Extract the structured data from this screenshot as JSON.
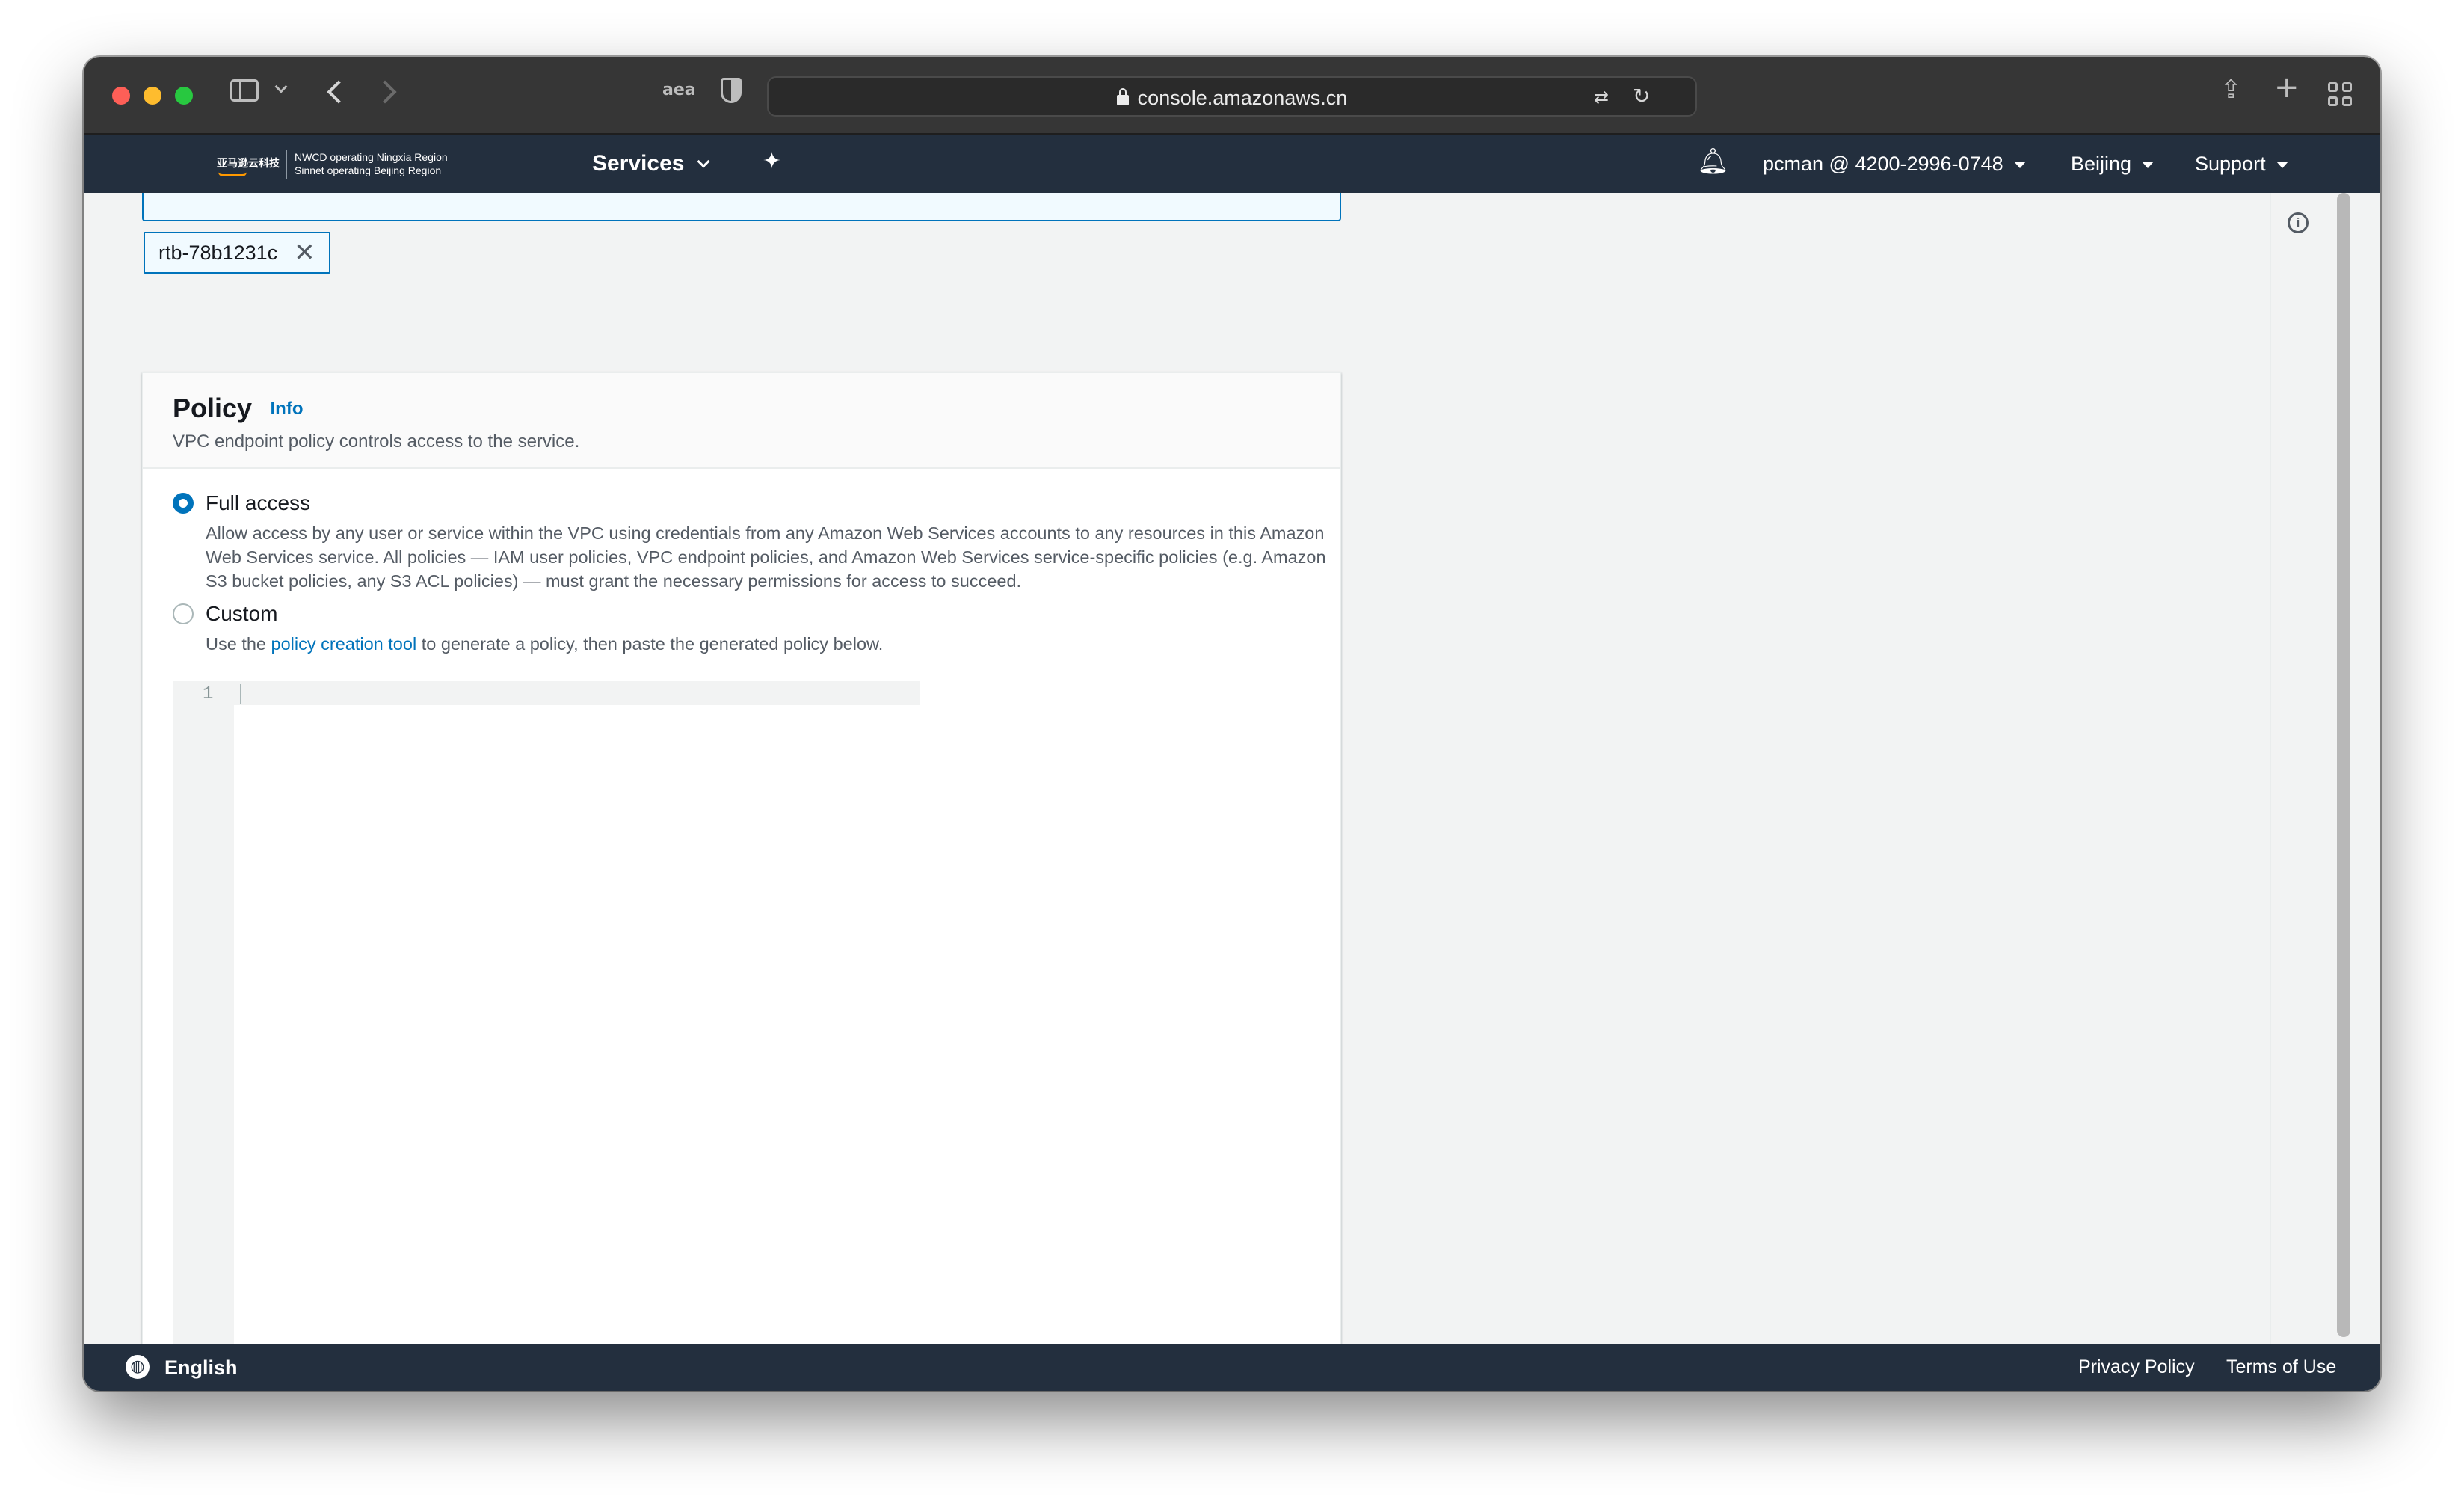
{
  "browser": {
    "url": "console.amazonaws.cn",
    "reader_label": "aea"
  },
  "nav": {
    "logo_cn": "亚马逊云科技",
    "logo_line1": "NWCD operating Ningxia Region",
    "logo_line2": "Sinnet operating Beijing Region",
    "services": "Services",
    "account": "pcman @ 4200-2996-0748",
    "region": "Beijing",
    "support": "Support"
  },
  "route_tables": {
    "selected_token": "rtb-78b1231c"
  },
  "policy": {
    "title": "Policy",
    "info_link": "Info",
    "description": "VPC endpoint policy controls access to the service.",
    "selected": "full_access",
    "full_access": {
      "label": "Full access",
      "description": "Allow access by any user or service within the VPC using credentials from any Amazon Web Services accounts to any resources in this Amazon Web Services service. All policies — IAM user policies, VPC endpoint policies, and Amazon Web Services service-specific policies (e.g. Amazon S3 bucket policies, any S3 ACL policies) — must grant the necessary permissions for access to succeed."
    },
    "custom": {
      "label": "Custom",
      "desc_prefix": "Use the ",
      "desc_link": "policy creation tool",
      "desc_suffix": " to generate a policy, then paste the generated policy below."
    },
    "editor_line_number": "1"
  },
  "footer": {
    "language": "English",
    "privacy": "Privacy Policy",
    "terms": "Terms of Use"
  },
  "colors": {
    "nav_bg": "#232f3e",
    "accent": "#0073bb",
    "page_bg": "#f2f3f3"
  }
}
